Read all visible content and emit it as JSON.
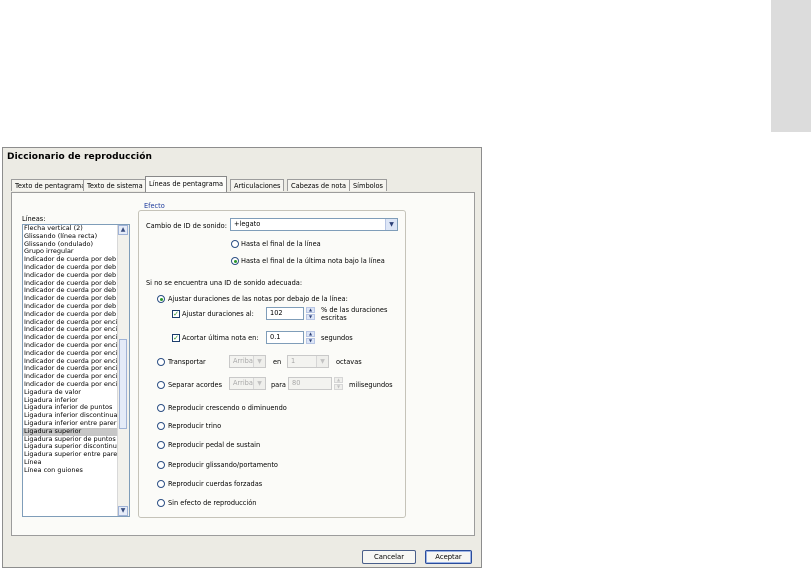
{
  "window": {
    "title": "Diccionario de reproducción"
  },
  "tabs": [
    {
      "label": "Texto de pentagrama"
    },
    {
      "label": "Texto de sistema"
    },
    {
      "label": "Líneas de pentagrama"
    },
    {
      "label": "Articulaciones"
    },
    {
      "label": "Cabezas de nota"
    },
    {
      "label": "Símbolos"
    }
  ],
  "lines_label": "Líneas:",
  "lines_list": [
    "Flecha vertical (2)",
    "Glissando (línea recta)",
    "Glissando (ondulado)",
    "Grupo irregular",
    "Indicador de cuerda por deb",
    "Indicador de cuerda por deb",
    "Indicador de cuerda por deb",
    "Indicador de cuerda por deb",
    "Indicador de cuerda por deb",
    "Indicador de cuerda por deb",
    "Indicador de cuerda por deb",
    "Indicador de cuerda por deb",
    "Indicador de cuerda por enci",
    "Indicador de cuerda por enci",
    "Indicador de cuerda por enci",
    "Indicador de cuerda por enci",
    "Indicador de cuerda por enci",
    "Indicador de cuerda por enci",
    "Indicador de cuerda por enci",
    "Indicador de cuerda por enci",
    "Indicador de cuerda por enci",
    "Ligadura de valor",
    "Ligadura inferior",
    "Ligadura inferior de puntos",
    "Ligadura inferior discontinua",
    "Ligadura inferior entre parer",
    "Ligadura superior",
    "Ligadura superior de puntos",
    "Ligadura superior discontinu",
    "Ligadura superior entre pare",
    "Línea",
    "Línea con guiones"
  ],
  "effect": {
    "group_title": "Efecto",
    "sound_id_label": "Cambio de ID de sonido:",
    "sound_id_value": "+legato",
    "scope_option_1": "Hasta el final de la línea",
    "scope_option_2": "Hasta el final de la última nota bajo la línea",
    "fallback_label": "Si no se encuentra una ID de sonido adecuada:",
    "adjust_durations": "Ajustar duraciones de las notas por debajo de la línea:",
    "adjust_to_label": "Ajustar duraciones al:",
    "adjust_to_value": "102",
    "adjust_to_unit_1": "% de las duraciones",
    "adjust_to_unit_2": "escritas",
    "shorten_last_label": "Acortar última nota en:",
    "shorten_last_value": "0.1",
    "shorten_last_unit": "segundos",
    "transpose": "Transportar",
    "transpose_dir": "Arriba",
    "transpose_en": "en",
    "transpose_count": "1",
    "transpose_unit": "octavas",
    "split_chords": "Separar acordes",
    "split_dir": "Arriba",
    "split_para": "para",
    "split_ms": "80",
    "split_unit": "milisegundos",
    "crescendo": "Reproducir crescendo o diminuendo",
    "trill": "Reproducir trino",
    "sustain": "Reproducir pedal de sustain",
    "glissando": "Reproducir glissando/portamento",
    "forced_strings": "Reproducir cuerdas forzadas",
    "no_effect": "Sin efecto de reproducción"
  },
  "buttons": {
    "cancel": "Cancelar",
    "accept": "Aceptar"
  }
}
